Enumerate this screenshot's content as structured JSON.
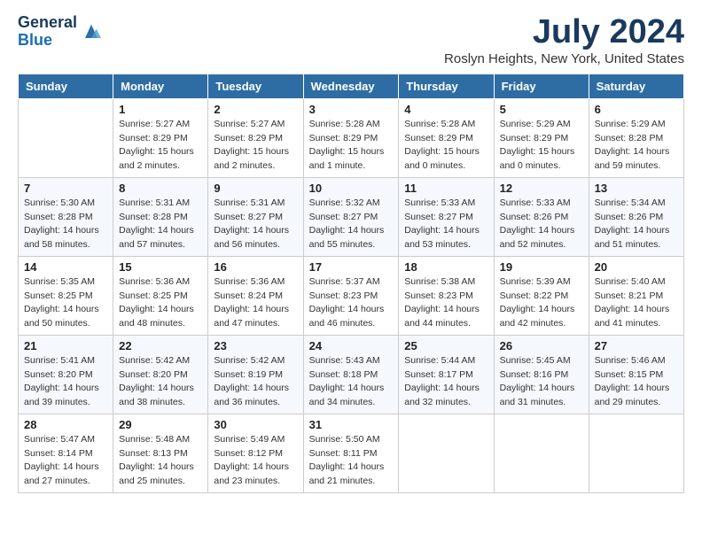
{
  "logo": {
    "general": "General",
    "blue": "Blue"
  },
  "title": "July 2024",
  "location": "Roslyn Heights, New York, United States",
  "days_of_week": [
    "Sunday",
    "Monday",
    "Tuesday",
    "Wednesday",
    "Thursday",
    "Friday",
    "Saturday"
  ],
  "weeks": [
    [
      {
        "day": "",
        "info": ""
      },
      {
        "day": "1",
        "info": "Sunrise: 5:27 AM\nSunset: 8:29 PM\nDaylight: 15 hours\nand 2 minutes."
      },
      {
        "day": "2",
        "info": "Sunrise: 5:27 AM\nSunset: 8:29 PM\nDaylight: 15 hours\nand 2 minutes."
      },
      {
        "day": "3",
        "info": "Sunrise: 5:28 AM\nSunset: 8:29 PM\nDaylight: 15 hours\nand 1 minute."
      },
      {
        "day": "4",
        "info": "Sunrise: 5:28 AM\nSunset: 8:29 PM\nDaylight: 15 hours\nand 0 minutes."
      },
      {
        "day": "5",
        "info": "Sunrise: 5:29 AM\nSunset: 8:29 PM\nDaylight: 15 hours\nand 0 minutes."
      },
      {
        "day": "6",
        "info": "Sunrise: 5:29 AM\nSunset: 8:28 PM\nDaylight: 14 hours\nand 59 minutes."
      }
    ],
    [
      {
        "day": "7",
        "info": "Sunrise: 5:30 AM\nSunset: 8:28 PM\nDaylight: 14 hours\nand 58 minutes."
      },
      {
        "day": "8",
        "info": "Sunrise: 5:31 AM\nSunset: 8:28 PM\nDaylight: 14 hours\nand 57 minutes."
      },
      {
        "day": "9",
        "info": "Sunrise: 5:31 AM\nSunset: 8:27 PM\nDaylight: 14 hours\nand 56 minutes."
      },
      {
        "day": "10",
        "info": "Sunrise: 5:32 AM\nSunset: 8:27 PM\nDaylight: 14 hours\nand 55 minutes."
      },
      {
        "day": "11",
        "info": "Sunrise: 5:33 AM\nSunset: 8:27 PM\nDaylight: 14 hours\nand 53 minutes."
      },
      {
        "day": "12",
        "info": "Sunrise: 5:33 AM\nSunset: 8:26 PM\nDaylight: 14 hours\nand 52 minutes."
      },
      {
        "day": "13",
        "info": "Sunrise: 5:34 AM\nSunset: 8:26 PM\nDaylight: 14 hours\nand 51 minutes."
      }
    ],
    [
      {
        "day": "14",
        "info": "Sunrise: 5:35 AM\nSunset: 8:25 PM\nDaylight: 14 hours\nand 50 minutes."
      },
      {
        "day": "15",
        "info": "Sunrise: 5:36 AM\nSunset: 8:25 PM\nDaylight: 14 hours\nand 48 minutes."
      },
      {
        "day": "16",
        "info": "Sunrise: 5:36 AM\nSunset: 8:24 PM\nDaylight: 14 hours\nand 47 minutes."
      },
      {
        "day": "17",
        "info": "Sunrise: 5:37 AM\nSunset: 8:23 PM\nDaylight: 14 hours\nand 46 minutes."
      },
      {
        "day": "18",
        "info": "Sunrise: 5:38 AM\nSunset: 8:23 PM\nDaylight: 14 hours\nand 44 minutes."
      },
      {
        "day": "19",
        "info": "Sunrise: 5:39 AM\nSunset: 8:22 PM\nDaylight: 14 hours\nand 42 minutes."
      },
      {
        "day": "20",
        "info": "Sunrise: 5:40 AM\nSunset: 8:21 PM\nDaylight: 14 hours\nand 41 minutes."
      }
    ],
    [
      {
        "day": "21",
        "info": "Sunrise: 5:41 AM\nSunset: 8:20 PM\nDaylight: 14 hours\nand 39 minutes."
      },
      {
        "day": "22",
        "info": "Sunrise: 5:42 AM\nSunset: 8:20 PM\nDaylight: 14 hours\nand 38 minutes."
      },
      {
        "day": "23",
        "info": "Sunrise: 5:42 AM\nSunset: 8:19 PM\nDaylight: 14 hours\nand 36 minutes."
      },
      {
        "day": "24",
        "info": "Sunrise: 5:43 AM\nSunset: 8:18 PM\nDaylight: 14 hours\nand 34 minutes."
      },
      {
        "day": "25",
        "info": "Sunrise: 5:44 AM\nSunset: 8:17 PM\nDaylight: 14 hours\nand 32 minutes."
      },
      {
        "day": "26",
        "info": "Sunrise: 5:45 AM\nSunset: 8:16 PM\nDaylight: 14 hours\nand 31 minutes."
      },
      {
        "day": "27",
        "info": "Sunrise: 5:46 AM\nSunset: 8:15 PM\nDaylight: 14 hours\nand 29 minutes."
      }
    ],
    [
      {
        "day": "28",
        "info": "Sunrise: 5:47 AM\nSunset: 8:14 PM\nDaylight: 14 hours\nand 27 minutes."
      },
      {
        "day": "29",
        "info": "Sunrise: 5:48 AM\nSunset: 8:13 PM\nDaylight: 14 hours\nand 25 minutes."
      },
      {
        "day": "30",
        "info": "Sunrise: 5:49 AM\nSunset: 8:12 PM\nDaylight: 14 hours\nand 23 minutes."
      },
      {
        "day": "31",
        "info": "Sunrise: 5:50 AM\nSunset: 8:11 PM\nDaylight: 14 hours\nand 21 minutes."
      },
      {
        "day": "",
        "info": ""
      },
      {
        "day": "",
        "info": ""
      },
      {
        "day": "",
        "info": ""
      }
    ]
  ]
}
